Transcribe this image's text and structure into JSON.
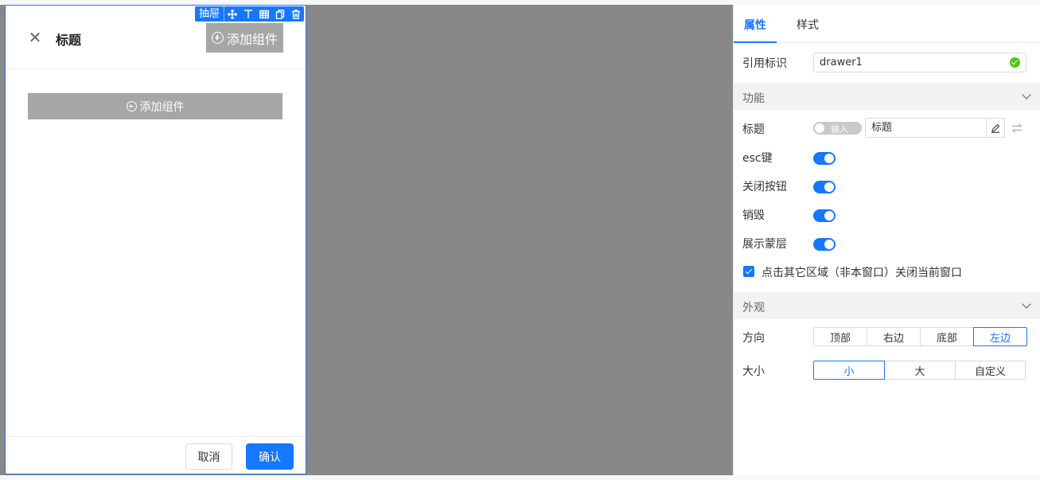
{
  "drawer": {
    "title": "标题",
    "header_add_label": "添加组件",
    "body_add_label": "添加组件",
    "cancel_label": "取消",
    "confirm_label": "确认"
  },
  "selection_toolbar": {
    "label": "抽屉",
    "icons": [
      "move-icon",
      "align-top-icon",
      "table-icon",
      "copy-icon",
      "delete-icon"
    ]
  },
  "panel": {
    "tabs": [
      {
        "label": "属性",
        "active": true
      },
      {
        "label": "样式",
        "active": false
      }
    ],
    "ref": {
      "label": "引用标识",
      "value": "drawer1"
    },
    "sections": {
      "function": "功能",
      "appearance": "外观"
    },
    "title_row": {
      "label": "标题",
      "toggle_label": "输入",
      "value": "标题"
    },
    "switches": [
      {
        "label": "esc键",
        "on": true
      },
      {
        "label": "关闭按钮",
        "on": true
      },
      {
        "label": "销毁",
        "on": true
      },
      {
        "label": "展示蒙层",
        "on": true
      }
    ],
    "checkbox": {
      "label": "点击其它区域（非本窗口）关闭当前窗口",
      "checked": true
    },
    "direction": {
      "label": "方向",
      "options": [
        "顶部",
        "右边",
        "底部",
        "左边"
      ],
      "selected": "左边"
    },
    "size": {
      "label": "大小",
      "options": [
        "小",
        "大",
        "自定义"
      ],
      "selected": "小"
    }
  },
  "colors": {
    "accent": "#1677ff",
    "canvas_bg": "#888888",
    "success": "#52c41a"
  }
}
